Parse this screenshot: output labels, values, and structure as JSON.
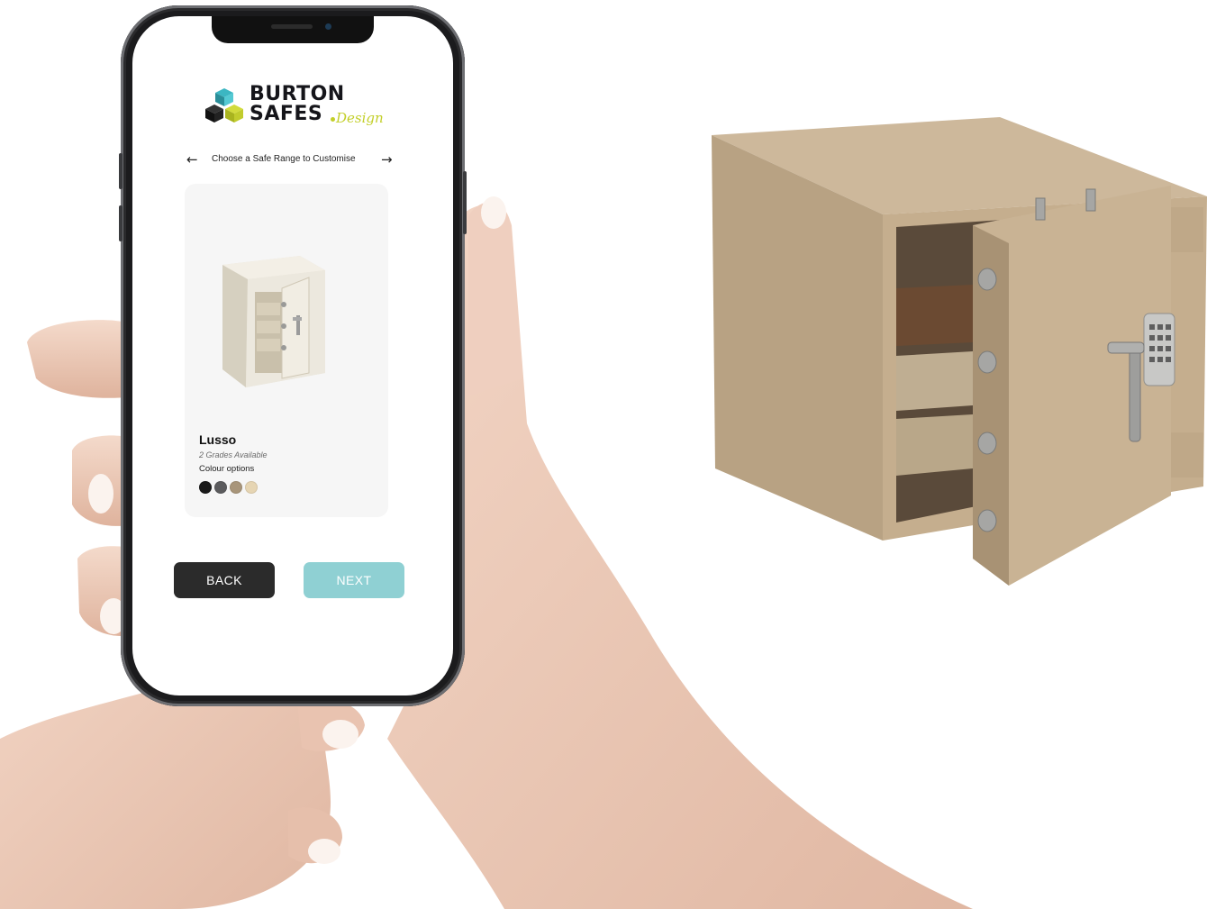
{
  "app": {
    "brand_line1": "BURTON",
    "brand_line2": "SAFES",
    "brand_script": "Design"
  },
  "nav": {
    "title": "Choose a Safe Range to Customise",
    "prev_icon": "arrow-left-icon",
    "next_icon": "arrow-right-icon"
  },
  "product": {
    "name": "Lusso",
    "grades": "2 Grades Available",
    "colour_label": "Colour options",
    "colours": [
      "#1a1a1a",
      "#5b5b5d",
      "#a8957a",
      "#e6d5b3"
    ]
  },
  "buttons": {
    "back": "BACK",
    "next": "NEXT"
  }
}
